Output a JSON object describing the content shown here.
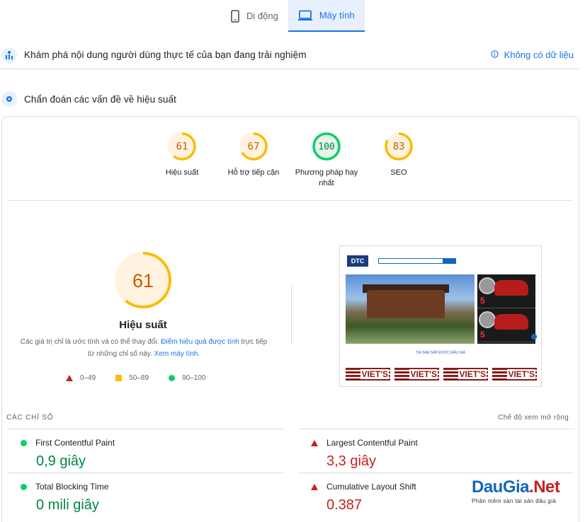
{
  "tabs": [
    {
      "label": "Di động",
      "icon": "mobile-icon"
    },
    {
      "label": "Máy tính",
      "icon": "desktop-icon",
      "active": true
    }
  ],
  "crux": {
    "title": "Khám phá nội dung người dùng thực tế của bạn đang trải nghiệm",
    "no_data": "Không có dữ liệu"
  },
  "diagnose": {
    "title": "Chẩn đoán các vấn đề về hiệu suất"
  },
  "categories": [
    {
      "score": "61",
      "label": "Hiệu suất",
      "value": 61,
      "color": "#e8710a",
      "bg": "#fff3e0"
    },
    {
      "score": "67",
      "label": "Hỗ trợ tiếp cận",
      "value": 67,
      "color": "#e8710a",
      "bg": "#fff3e0"
    },
    {
      "score": "100",
      "label": "Phương pháp hay nhất",
      "value": 100,
      "color": "#0cce6b",
      "bg": "#e6f4ea"
    },
    {
      "score": "83",
      "label": "SEO",
      "value": 83,
      "color": "#e8710a",
      "bg": "#fff3e0"
    }
  ],
  "performance": {
    "score": "61",
    "value": 61,
    "label": "Hiệu suất",
    "note_prefix": "Các giá trị chỉ là ước tính và có thể thay đổi. ",
    "note_link": "Điểm hiệu quả được tính",
    "note_mid": " trực tiếp từ những chỉ số này. ",
    "note_link2": "Xem máy tính."
  },
  "legend": [
    {
      "range": "0–49",
      "shape": "triangle",
      "color": "#c5221f"
    },
    {
      "range": "50–89",
      "shape": "square",
      "color": "#fbbc04"
    },
    {
      "range": "90–100",
      "shape": "circle",
      "color": "#0cce6b"
    }
  ],
  "metrics_header": {
    "title": "CÁC CHỈ SỐ",
    "expand": "Chế độ xem mở rộng"
  },
  "metrics": [
    {
      "name": "First Contentful Paint",
      "value": "0,9 giây",
      "status": "good"
    },
    {
      "name": "Largest Contentful Paint",
      "value": "3,3 giây",
      "status": "bad"
    },
    {
      "name": "Total Blocking Time",
      "value": "0 mili giây",
      "status": "good"
    },
    {
      "name": "Cumulative Layout Shift",
      "value": "0.387",
      "status": "bad"
    }
  ],
  "thumbnail": {
    "logo": "DTC",
    "caption": "TÀI SẢN SẮP ĐƯỢC ĐẤU GIÁ",
    "banner_text": "VIET'S",
    "ad_number": "5"
  },
  "watermark": {
    "brand_a": "DauGia",
    "brand_b": ".Net",
    "subtitle": "Phần mềm sàn tài sản đấu giá"
  }
}
